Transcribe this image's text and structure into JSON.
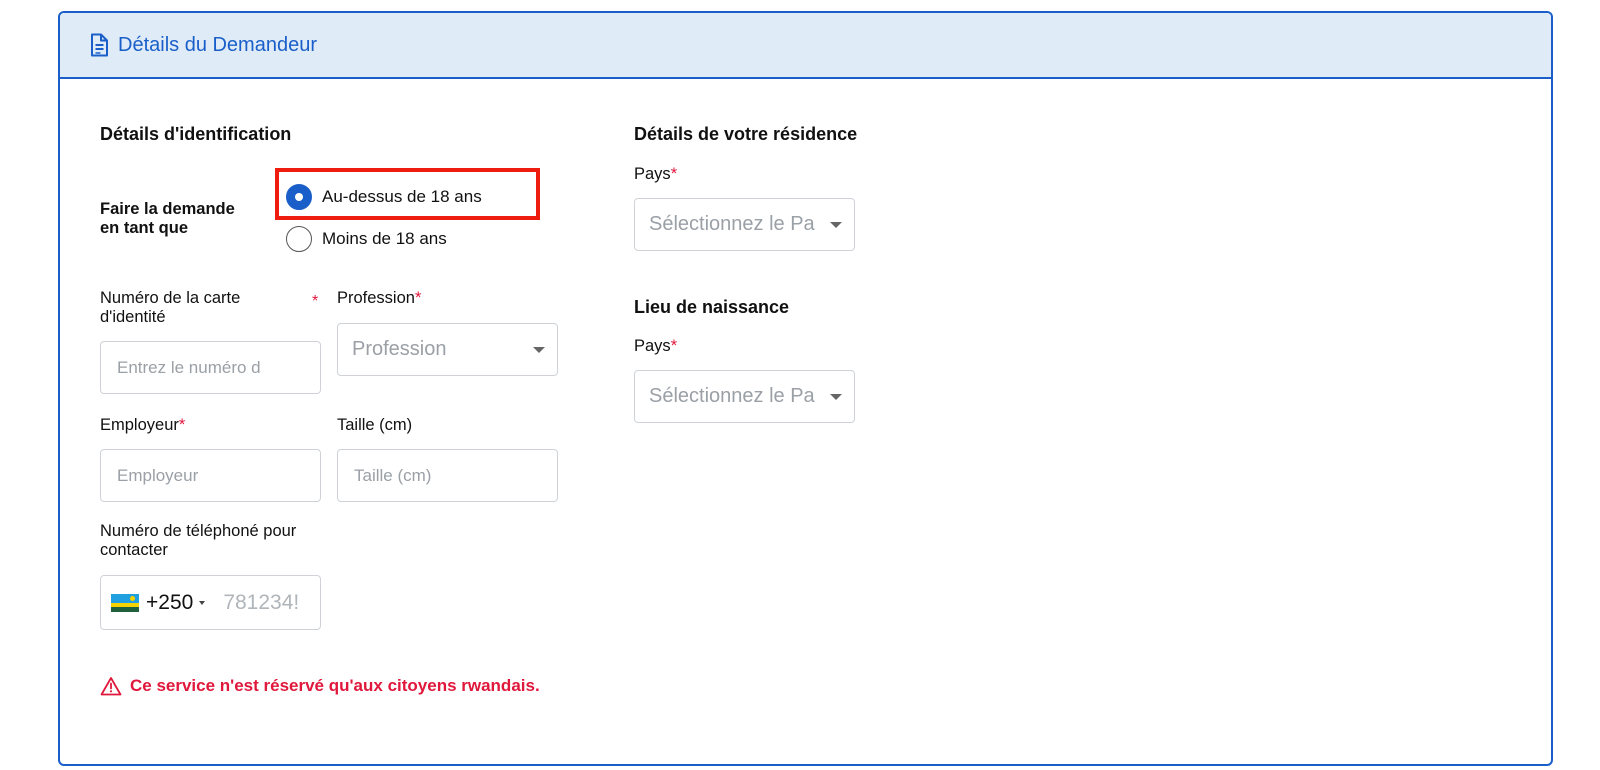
{
  "header": {
    "title": "Détails du Demandeur",
    "icon": "document-icon"
  },
  "identification": {
    "title": "Détails d'identification",
    "apply_as_label": "Faire la demande\nen tant que",
    "options": [
      {
        "label": "Au-dessus de 18 ans",
        "checked": true
      },
      {
        "label": "Moins de 18 ans",
        "checked": false
      }
    ],
    "id_number": {
      "label": "Numéro de la carte d'identité",
      "placeholder": "Entrez le numéro d",
      "required_mark": "*"
    },
    "profession": {
      "label": "Profession",
      "placeholder": "Profession",
      "required_mark": "*"
    },
    "employer": {
      "label": "Employeur",
      "placeholder": "Employeur",
      "required_mark": "*"
    },
    "height": {
      "label": "Taille (cm)",
      "placeholder": "Taille (cm)"
    },
    "phone": {
      "label": "Numéro de téléphoné pour contacter",
      "dial_code": "+250",
      "placeholder": "781234!"
    }
  },
  "residence": {
    "title": "Détails de votre résidence",
    "country_label": "Pays",
    "country_placeholder": "Sélectionnez le Pa",
    "required_mark": "*"
  },
  "birthplace": {
    "title": "Lieu de naissance",
    "country_label": "Pays",
    "country_placeholder": "Sélectionnez le Pa",
    "required_mark": "*"
  },
  "warning": {
    "text": "Ce service n'est réservé qu'aux citoyens rwandais.",
    "icon": "warning-icon"
  },
  "colors": {
    "accent": "#1a5fc9",
    "header_bg": "#dfecf8",
    "error": "#e0183c",
    "highlight": "#ef1d0f"
  }
}
